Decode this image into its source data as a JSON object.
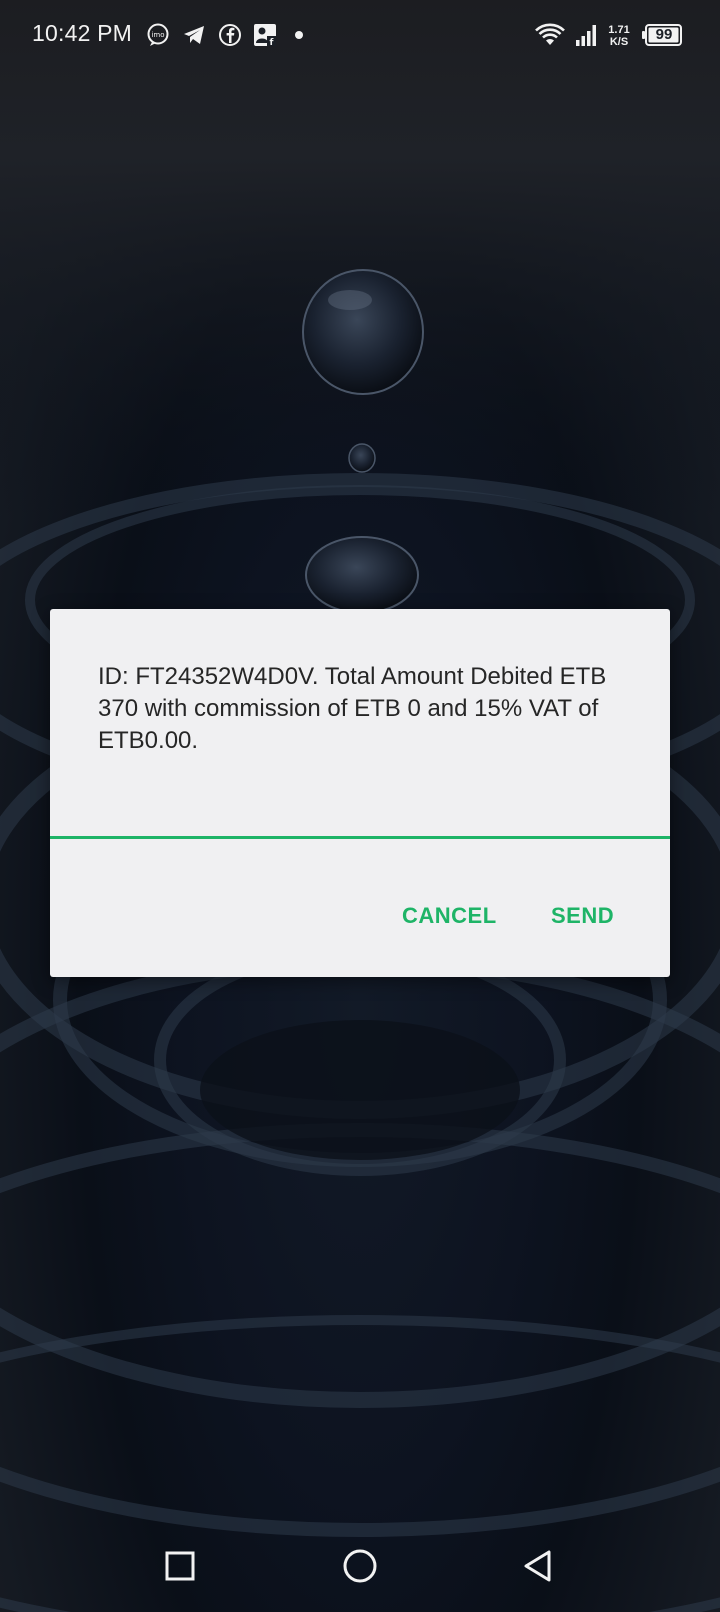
{
  "status_bar": {
    "time": "10:42 PM",
    "notification_icons": [
      "imo-icon",
      "telegram-icon",
      "facebook-icon",
      "facebook-page-icon",
      "dot-icon"
    ],
    "net_speed_value": "1.71",
    "net_speed_unit": "K/S",
    "battery_level": "99"
  },
  "dialog": {
    "message": "ID: FT24352W4D0V. Total Amount Debited ETB 370 with commission of ETB 0 and 15% VAT of ETB0.00.",
    "cancel_label": "CANCEL",
    "send_label": "SEND",
    "accent_color": "#1eb467"
  },
  "nav_bar": {
    "icons": [
      "recents-square-icon",
      "home-circle-icon",
      "back-triangle-icon"
    ]
  }
}
